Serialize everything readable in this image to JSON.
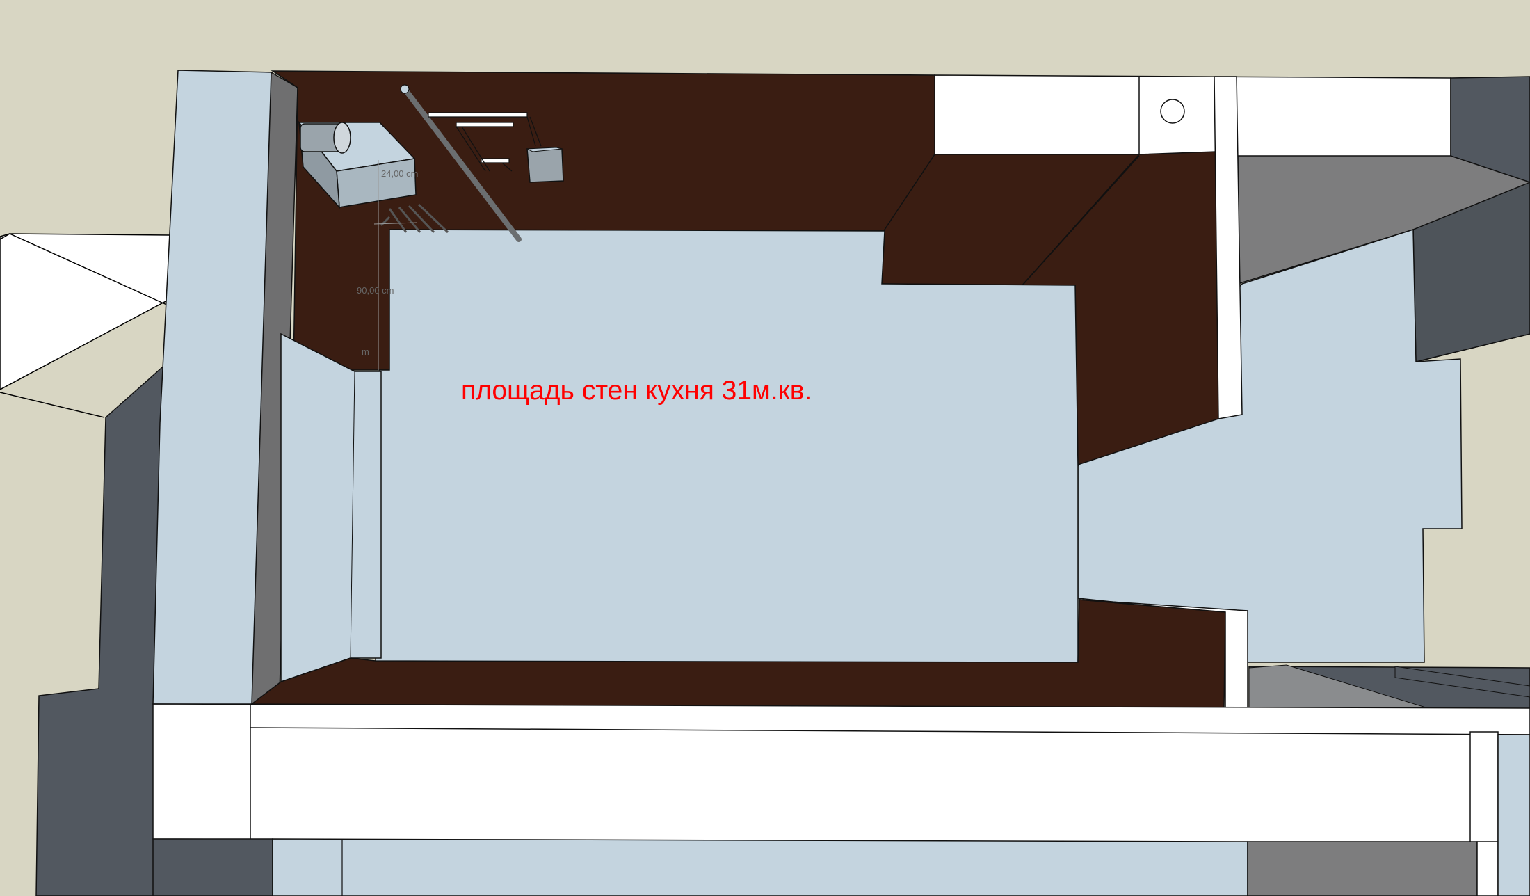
{
  "canvas": {
    "background": "#d8d6c3",
    "wall_color": "#c4d4df",
    "wood_color": "#3a1d12",
    "white_color": "#ffffff",
    "shadow_color": "#484e54",
    "caption_color": "#ff0000",
    "dimension_color": "#666666"
  },
  "annotations": {
    "caption": "площадь стен кухня 31м.кв.",
    "dimension_height": "24,00 cm",
    "dimension_width": "90,00 cm",
    "dimension_partial": "m"
  },
  "objects": {
    "ventilation_duct": "cylinder",
    "gas_pipe": "pipe",
    "socket_box": "box",
    "round_opening": "circle"
  }
}
